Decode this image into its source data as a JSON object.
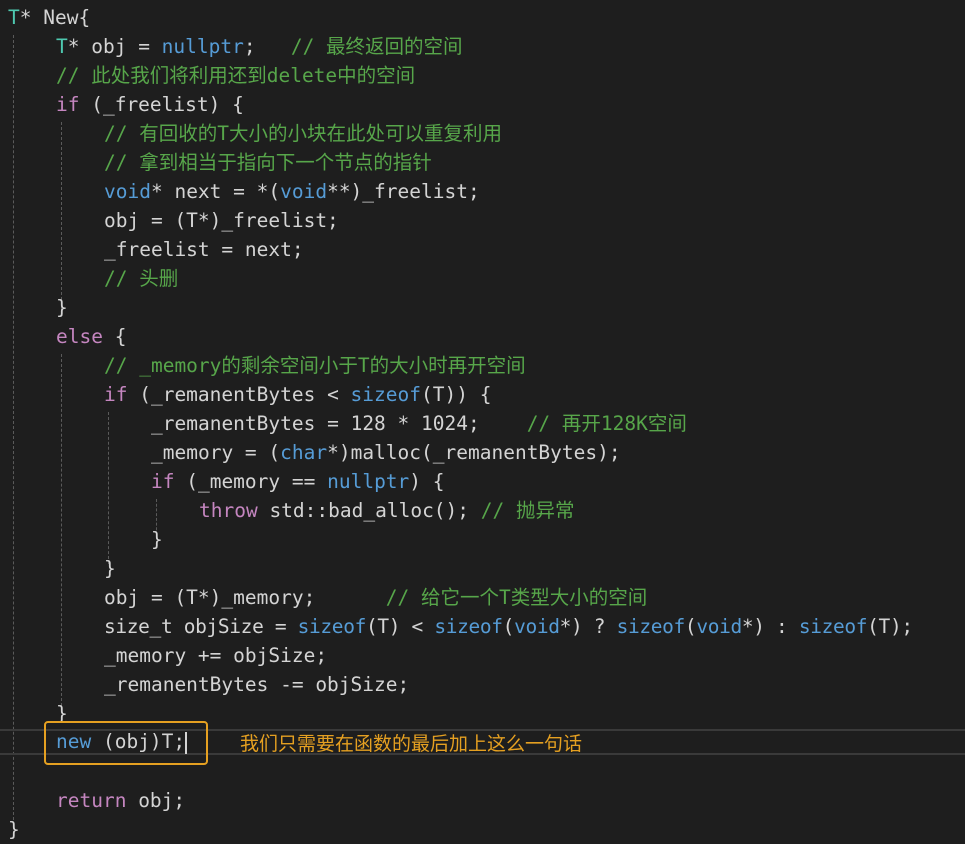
{
  "code": {
    "l01": {
      "type": "T",
      "sig": "* New{"
    },
    "l02": {
      "type": "T",
      "a": "* obj = ",
      "kw": "nullptr",
      "b": ";   ",
      "comment": "// 最终返回的空间"
    },
    "l03": {
      "comment": "// 此处我们将利用还到delete中的空间"
    },
    "l04": {
      "kw": "if",
      "rest": " (_freelist) {"
    },
    "l05": {
      "comment": "// 有回收的T大小的小块在此处可以重复利用"
    },
    "l06": {
      "comment": "// 拿到相当于指向下一个节点的指针"
    },
    "l07": {
      "kw1": "void",
      "a": "* next = *(",
      "kw2": "void",
      "b": "**)_freelist;"
    },
    "l08": {
      "text": "obj = (T*)_freelist;"
    },
    "l09": {
      "text": "_freelist = next;"
    },
    "l10": {
      "comment": "// 头删"
    },
    "l11": {
      "text": "}"
    },
    "l12": {
      "kw": "else",
      "rest": " {"
    },
    "l13": {
      "comment": "// _memory的剩余空间小于T的大小时再开空间"
    },
    "l14": {
      "kw": "if",
      "a": " (_remanentBytes < ",
      "kw2": "sizeof",
      "b": "(T)) {"
    },
    "l15": {
      "text": "_remanentBytes = 128 * 1024;    ",
      "comment": "// 再开128K空间"
    },
    "l16": {
      "a": "_memory = (",
      "kw": "char",
      "b": "*)malloc(_remanentBytes);"
    },
    "l17": {
      "kw": "if",
      "a": " (_memory == ",
      "kw2": "nullptr",
      "b": ") {"
    },
    "l18": {
      "kw": "throw",
      "a": " std::bad_alloc(); ",
      "comment": "// 抛异常"
    },
    "l19": {
      "text": "}"
    },
    "l20": {
      "text": "}"
    },
    "l21": {
      "text": "obj = (T*)_memory;      ",
      "comment": "// 给它一个T类型大小的空间"
    },
    "l22": {
      "a": "size_t objSize = ",
      "k1": "sizeof",
      "b": "(T) < ",
      "k2": "sizeof",
      "c": "(",
      "k3": "void",
      "d": "*) ? ",
      "k4": "sizeof",
      "e": "(",
      "k5": "void",
      "f": "*) : ",
      "k6": "sizeof",
      "g": "(T);"
    },
    "l23": {
      "text": "_memory += objSize;"
    },
    "l24": {
      "text": "_remanentBytes -= objSize;"
    },
    "l25": {
      "text": "}"
    },
    "l26": {
      "kw": "new",
      "rest": " (obj)T;"
    },
    "l27": {
      "kw": "return",
      "rest": " obj;"
    },
    "l28": {
      "text": "}"
    }
  },
  "annotation": "我们只需要在函数的最后加上这么一句话",
  "colors": {
    "background": "#1e1e1e",
    "keyword": "#569cd6",
    "control": "#c586c0",
    "type": "#4ec9b0",
    "comment": "#57a64a",
    "highlight": "#e5a021"
  }
}
